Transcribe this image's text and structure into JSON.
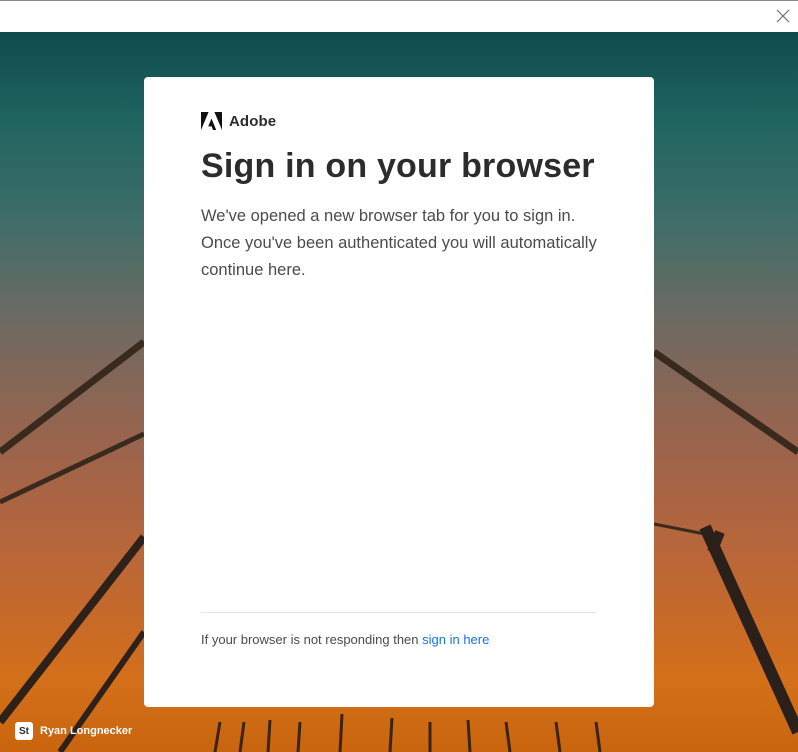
{
  "window": {
    "close_icon": "close-icon"
  },
  "card": {
    "brand_name": "Adobe",
    "brand_icon": "adobe-logo-icon",
    "title": "Sign in on your browser",
    "description": "We've opened a new browser tab for you to sign in. Once you've been authenticated you will automatically continue here.",
    "footer_text": "If your browser is not responding then ",
    "footer_link": "sign in here",
    "link_color": "#1473e6"
  },
  "user": {
    "app_badge": "St",
    "name": "Ryan Longnecker"
  }
}
